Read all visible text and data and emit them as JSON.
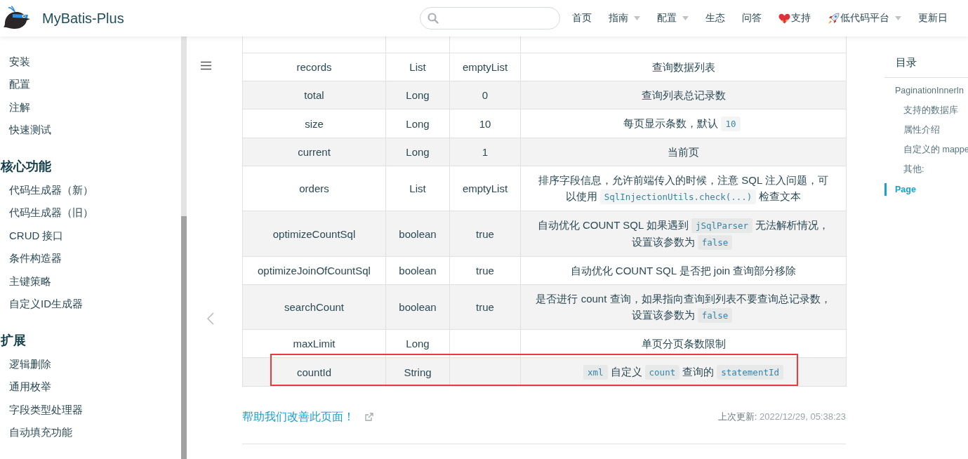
{
  "navbar": {
    "site_title": "MyBatis-Plus",
    "links": [
      {
        "label": "首页",
        "kind": "text",
        "dropdown": false
      },
      {
        "label": "指南",
        "kind": "text",
        "dropdown": true
      },
      {
        "label": "配置",
        "kind": "text",
        "dropdown": true
      },
      {
        "label": "生态",
        "kind": "text",
        "dropdown": false
      },
      {
        "label": "问答",
        "kind": "text",
        "dropdown": false
      },
      {
        "label": "支持",
        "kind": "support",
        "dropdown": false
      },
      {
        "label": "低代码平台",
        "kind": "platform",
        "dropdown": true
      },
      {
        "label": "更新日",
        "kind": "text",
        "dropdown": false
      }
    ]
  },
  "sidebar": {
    "groups": [
      {
        "items": [
          "安装",
          "配置",
          "注解",
          "快速测试"
        ]
      },
      {
        "heading": "核心功能",
        "items": [
          "代码生成器（新）",
          "代码生成器（旧）",
          "CRUD 接口",
          "条件构造器",
          "主键策略",
          "自定义ID生成器"
        ]
      },
      {
        "heading": "扩展",
        "items": [
          "逻辑删除",
          "通用枚举",
          "字段类型处理器",
          "自动填充功能"
        ]
      }
    ]
  },
  "table": {
    "rows": [
      {
        "name": "records",
        "type": "List",
        "default": "emptyList",
        "description": [
          {
            "kind": "text",
            "text": "查询数据列表"
          }
        ],
        "highlighted": false
      },
      {
        "name": "total",
        "type": "Long",
        "default": "0",
        "description": [
          {
            "kind": "text",
            "text": "查询列表总记录数"
          }
        ],
        "highlighted": false
      },
      {
        "name": "size",
        "type": "Long",
        "default": "10",
        "description": [
          {
            "kind": "text",
            "text": "每页显示条数，默认"
          },
          {
            "kind": "code",
            "text": "10"
          }
        ],
        "highlighted": false
      },
      {
        "name": "current",
        "type": "Long",
        "default": "1",
        "description": [
          {
            "kind": "text",
            "text": "当前页"
          }
        ],
        "highlighted": false
      },
      {
        "name": "orders",
        "type": "List",
        "default": "emptyList",
        "description": [
          {
            "kind": "text",
            "text": "排序字段信息，允许前端传入的时候，注意 SQL 注入问题，可以使用"
          },
          {
            "kind": "code",
            "text": "SqlInjectionUtils.check(...)"
          },
          {
            "kind": "text",
            "text": "检查文本"
          }
        ],
        "highlighted": false
      },
      {
        "name": "optimizeCountSql",
        "type": "boolean",
        "default": "true",
        "description": [
          {
            "kind": "text",
            "text": "自动优化 COUNT SQL 如果遇到"
          },
          {
            "kind": "code",
            "text": "jSqlParser"
          },
          {
            "kind": "text",
            "text": "无法解析情况，设置该参数为"
          },
          {
            "kind": "code",
            "text": "false"
          }
        ],
        "highlighted": false
      },
      {
        "name": "optimizeJoinOfCountSql",
        "type": "boolean",
        "default": "true",
        "description": [
          {
            "kind": "text",
            "text": "自动优化 COUNT SQL 是否把 join 查询部分移除"
          }
        ],
        "highlighted": false
      },
      {
        "name": "searchCount",
        "type": "boolean",
        "default": "true",
        "description": [
          {
            "kind": "text",
            "text": "是否进行 count 查询，如果指向查询到列表不要查询总记录数，设置该参数为"
          },
          {
            "kind": "code",
            "text": "false"
          }
        ],
        "highlighted": false
      },
      {
        "name": "maxLimit",
        "type": "Long",
        "description": [
          {
            "kind": "text",
            "text": "单页分页条数限制"
          }
        ],
        "highlighted": false
      },
      {
        "name": "countId",
        "type": "String",
        "description": [
          {
            "kind": "code",
            "text": "xml"
          },
          {
            "kind": "text",
            "text": "自定义"
          },
          {
            "kind": "code",
            "text": "count"
          },
          {
            "kind": "text",
            "text": "查询的"
          },
          {
            "kind": "code",
            "text": "statementId"
          }
        ],
        "highlighted": true
      }
    ]
  },
  "footer": {
    "edit_link": "帮助我们改善此页面！",
    "last_updated_label": "上次更新:",
    "last_updated": "2022/12/29, 05:38:23"
  },
  "toc": {
    "title": "目录",
    "items": [
      {
        "label": "PaginationInnerIn",
        "selected": false,
        "children": [
          {
            "label": "支持的数据库",
            "selected": false
          },
          {
            "label": "属性介绍",
            "selected": false
          },
          {
            "label": "自定义的 mappe",
            "selected": false
          },
          {
            "label": "其他:",
            "selected": false
          }
        ]
      },
      {
        "label": "Page",
        "selected": true
      }
    ]
  }
}
